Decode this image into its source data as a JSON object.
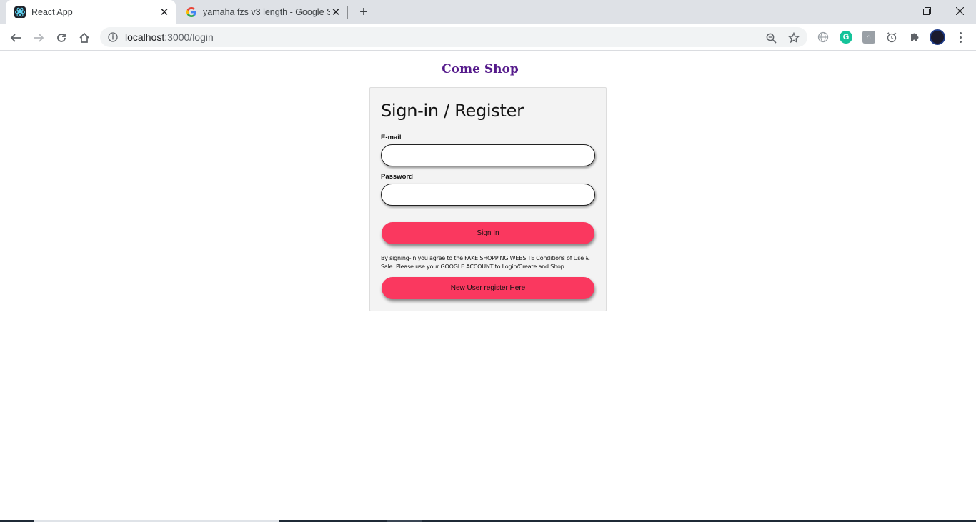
{
  "browser": {
    "tabs": [
      {
        "title": "React App",
        "favicon": "react-icon",
        "active": true
      },
      {
        "title": "yamaha fzs v3 length - Google Se",
        "favicon": "google-icon",
        "active": false
      }
    ],
    "url": {
      "host": "localhost",
      "path": ":3000/login"
    },
    "extensions": [
      "globe-icon",
      "grammarly-icon",
      "tool-icon",
      "alarm-icon",
      "puzzle-icon"
    ]
  },
  "page": {
    "brand": "Come Shop",
    "heading": "Sign-in / Register",
    "email_label": "E-mail",
    "email_value": "",
    "password_label": "Password",
    "password_value": "",
    "signin_label": "Sign In",
    "terms": "By signing-in you agree to the FAKE SHOPPING WEBSITE Conditions of Use & Sale. Please use your GOOGLE ACCOUNT to Login/Create and Shop.",
    "register_label": "New User register Here"
  },
  "colors": {
    "accent": "#fa385f",
    "brand_link": "#551a8b",
    "card_bg": "#f3f3f3"
  }
}
